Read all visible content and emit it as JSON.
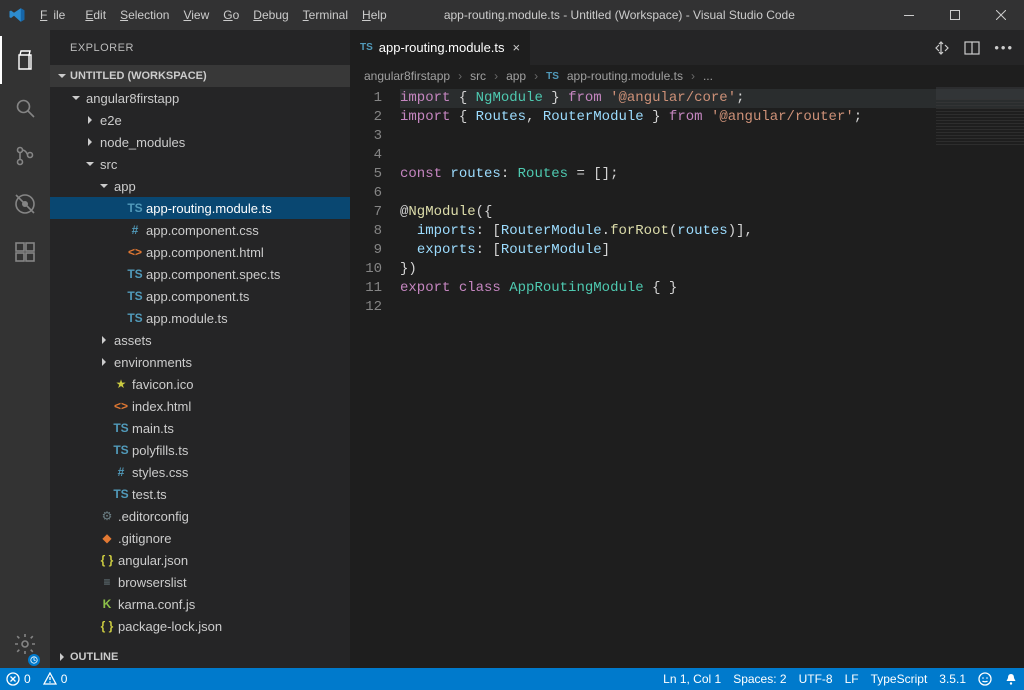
{
  "window": {
    "title": "app-routing.module.ts - Untitled (Workspace) - Visual Studio Code"
  },
  "menu": {
    "file": "File",
    "edit": "Edit",
    "selection": "Selection",
    "view": "View",
    "go": "Go",
    "debug": "Debug",
    "terminal": "Terminal",
    "help": "Help"
  },
  "sidebar": {
    "title": "EXPLORER",
    "workspace": "UNTITLED (WORKSPACE)",
    "outline": "OUTLINE",
    "tree": [
      {
        "d": 1,
        "kind": "folder",
        "open": true,
        "label": "angular8firstapp"
      },
      {
        "d": 2,
        "kind": "folder",
        "open": false,
        "label": "e2e"
      },
      {
        "d": 2,
        "kind": "folder",
        "open": false,
        "label": "node_modules"
      },
      {
        "d": 2,
        "kind": "folder",
        "open": true,
        "label": "src"
      },
      {
        "d": 3,
        "kind": "folder",
        "open": true,
        "label": "app"
      },
      {
        "d": 4,
        "kind": "ts",
        "label": "app-routing.module.ts",
        "selected": true
      },
      {
        "d": 4,
        "kind": "hash",
        "label": "app.component.css"
      },
      {
        "d": 4,
        "kind": "html",
        "label": "app.component.html"
      },
      {
        "d": 4,
        "kind": "ts",
        "label": "app.component.spec.ts"
      },
      {
        "d": 4,
        "kind": "ts",
        "label": "app.component.ts"
      },
      {
        "d": 4,
        "kind": "ts",
        "label": "app.module.ts"
      },
      {
        "d": 3,
        "kind": "folder",
        "open": false,
        "label": "assets"
      },
      {
        "d": 3,
        "kind": "folder",
        "open": false,
        "label": "environments"
      },
      {
        "d": 3,
        "kind": "star",
        "label": "favicon.ico"
      },
      {
        "d": 3,
        "kind": "html",
        "label": "index.html"
      },
      {
        "d": 3,
        "kind": "ts",
        "label": "main.ts"
      },
      {
        "d": 3,
        "kind": "ts",
        "label": "polyfills.ts"
      },
      {
        "d": 3,
        "kind": "hash",
        "label": "styles.css"
      },
      {
        "d": 3,
        "kind": "ts",
        "label": "test.ts"
      },
      {
        "d": 2,
        "kind": "gear",
        "label": ".editorconfig"
      },
      {
        "d": 2,
        "kind": "git",
        "label": ".gitignore"
      },
      {
        "d": 2,
        "kind": "json",
        "label": "angular.json"
      },
      {
        "d": 2,
        "kind": "list",
        "label": "browserslist"
      },
      {
        "d": 2,
        "kind": "k",
        "label": "karma.conf.js"
      },
      {
        "d": 2,
        "kind": "json",
        "label": "package-lock.json"
      }
    ]
  },
  "tabs": {
    "active": {
      "icon": "TS",
      "label": "app-routing.module.ts"
    }
  },
  "breadcrumbs": [
    "angular8firstapp",
    "src",
    "app",
    "app-routing.module.ts",
    "..."
  ],
  "code": {
    "lines": [
      [
        [
          "k",
          "import"
        ],
        [
          "p",
          " { "
        ],
        [
          "t",
          "NgModule"
        ],
        [
          "p",
          " } "
        ],
        [
          "k",
          "from"
        ],
        [
          "p",
          " "
        ],
        [
          "s",
          "'@angular/core'"
        ],
        [
          "p",
          ";"
        ]
      ],
      [
        [
          "k",
          "import"
        ],
        [
          "p",
          " { "
        ],
        [
          "i",
          "Routes"
        ],
        [
          "p",
          ", "
        ],
        [
          "i",
          "RouterModule"
        ],
        [
          "p",
          " } "
        ],
        [
          "k",
          "from"
        ],
        [
          "p",
          " "
        ],
        [
          "s",
          "'@angular/router'"
        ],
        [
          "p",
          ";"
        ]
      ],
      [],
      [],
      [
        [
          "k",
          "const"
        ],
        [
          "p",
          " "
        ],
        [
          "i",
          "routes"
        ],
        [
          "p",
          ": "
        ],
        [
          "t",
          "Routes"
        ],
        [
          "p",
          " = [];"
        ]
      ],
      [],
      [
        [
          "p",
          "@"
        ],
        [
          "f",
          "NgModule"
        ],
        [
          "p",
          "({"
        ]
      ],
      [
        [
          "p",
          "  "
        ],
        [
          "i",
          "imports"
        ],
        [
          "p",
          ": ["
        ],
        [
          "i",
          "RouterModule"
        ],
        [
          "p",
          "."
        ],
        [
          "f",
          "forRoot"
        ],
        [
          "p",
          "("
        ],
        [
          "i",
          "routes"
        ],
        [
          "p",
          ")],"
        ]
      ],
      [
        [
          "p",
          "  "
        ],
        [
          "i",
          "exports"
        ],
        [
          "p",
          ": ["
        ],
        [
          "i",
          "RouterModule"
        ],
        [
          "p",
          "]"
        ]
      ],
      [
        [
          "p",
          "})"
        ]
      ],
      [
        [
          "k",
          "export"
        ],
        [
          "p",
          " "
        ],
        [
          "k",
          "class"
        ],
        [
          "p",
          " "
        ],
        [
          "t",
          "AppRoutingModule"
        ],
        [
          "p",
          " { }"
        ]
      ],
      []
    ]
  },
  "status": {
    "errors": "0",
    "warnings": "0",
    "ln": "Ln 1, Col 1",
    "spaces": "Spaces: 2",
    "enc": "UTF-8",
    "eol": "LF",
    "lang": "TypeScript",
    "ver": "3.5.1"
  }
}
